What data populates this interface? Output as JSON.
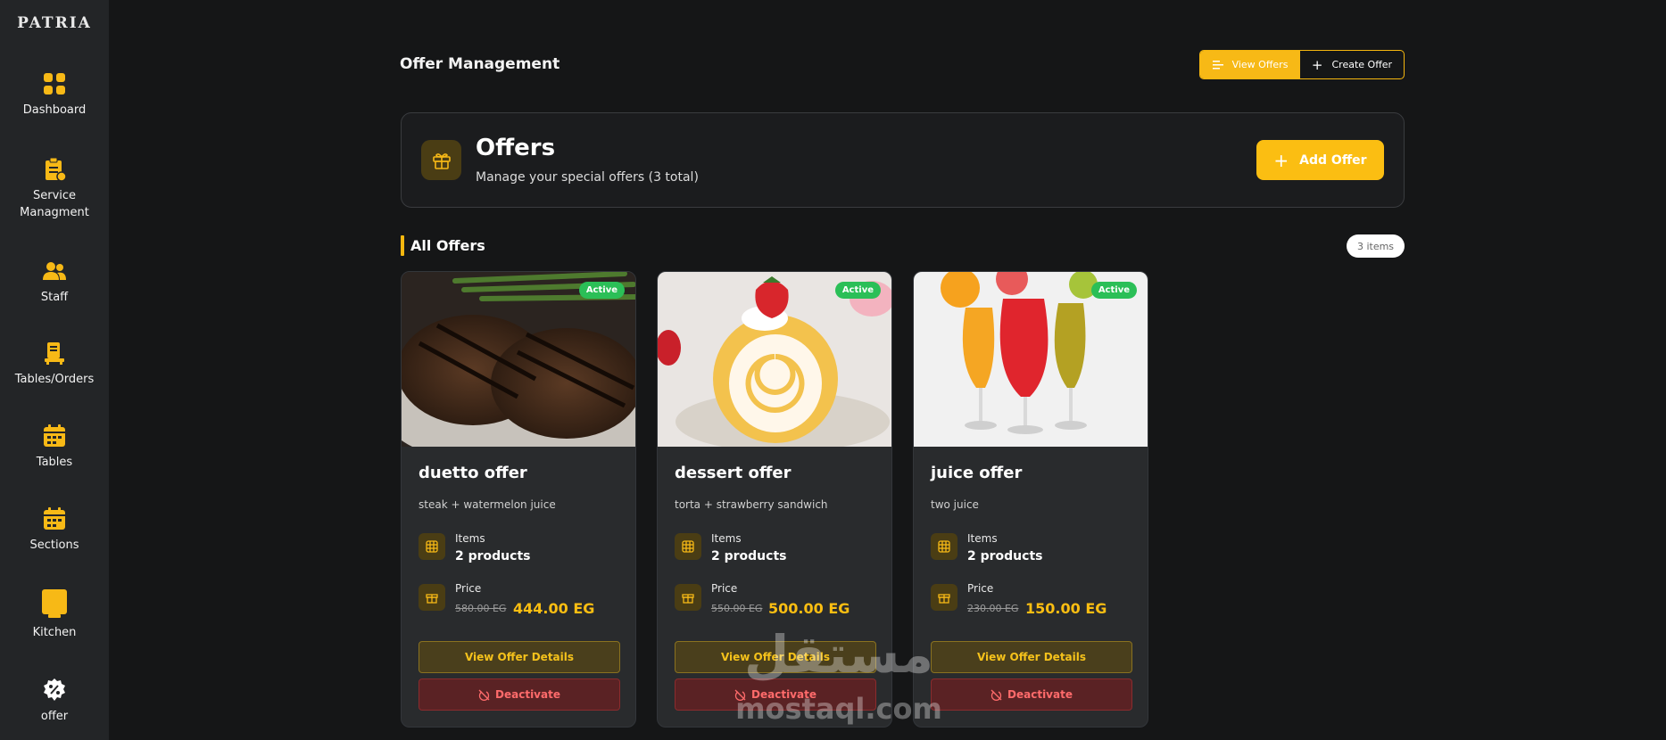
{
  "app": {
    "logo": "PATRIA"
  },
  "sidebar": {
    "items": [
      {
        "label": "Dashboard",
        "icon": "dashboard-icon"
      },
      {
        "label": "Service\nManagment",
        "icon": "clipboard-icon"
      },
      {
        "label": "Staff",
        "icon": "staff-icon"
      },
      {
        "label": "Tables/Orders",
        "icon": "tables-orders-icon"
      },
      {
        "label": "Tables",
        "icon": "calendar-icon"
      },
      {
        "label": "Sections",
        "icon": "calendar-icon"
      },
      {
        "label": "Kitchen",
        "icon": "kitchen-icon"
      },
      {
        "label": "offer",
        "icon": "percent-badge-icon"
      }
    ]
  },
  "header": {
    "title": "Offer Management",
    "view_offers": "View Offers",
    "create_offer": "Create Offer"
  },
  "hero": {
    "title": "Offers",
    "subtitle": "Manage your special offers (3 total)",
    "add_button": "Add Offer"
  },
  "section": {
    "title": "All Offers",
    "count": "3 items"
  },
  "offers": [
    {
      "status": "Active",
      "title": "duetto offer",
      "description": "steak + watermelon juice",
      "items_label": "Items",
      "items_value": "2 products",
      "price_label": "Price",
      "old_price": "580.00 EG",
      "new_price": "444.00 EG",
      "view_label": "View Offer Details",
      "deactivate_label": "Deactivate",
      "image": "grilled-steak-photo"
    },
    {
      "status": "Active",
      "title": "dessert offer",
      "description": "torta + strawberry sandwich",
      "items_label": "Items",
      "items_value": "2 products",
      "price_label": "Price",
      "old_price": "550.00 EG",
      "new_price": "500.00 EG",
      "view_label": "View Offer Details",
      "deactivate_label": "Deactivate",
      "image": "swiss-roll-cake-photo"
    },
    {
      "status": "Active",
      "title": "juice offer",
      "description": "two juice",
      "items_label": "Items",
      "items_value": "2 products",
      "price_label": "Price",
      "old_price": "230.00 EG",
      "new_price": "150.00 EG",
      "view_label": "View Offer Details",
      "deactivate_label": "Deactivate",
      "image": "juice-glasses-photo"
    }
  ],
  "watermark": {
    "arabic": "مستقل",
    "latin": "mostaql.com"
  },
  "colors": {
    "accent": "#fbbe12",
    "active": "#2bbf57",
    "danger": "#ff6b6b",
    "sidebar": "#232527",
    "background": "#151617"
  }
}
